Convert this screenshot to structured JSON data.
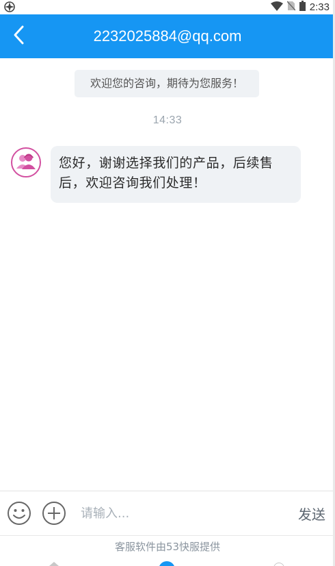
{
  "status_bar": {
    "time": "2:33",
    "icons": [
      "app-notification-icon",
      "wifi-icon",
      "no-sim-icon",
      "battery-icon"
    ]
  },
  "header": {
    "title": "2232025884@qq.com",
    "back_icon": "chevron-left-icon",
    "background_color": "#1696f3"
  },
  "chat": {
    "welcome_text": "欢迎您的咨询，期待为您服务！",
    "timestamp": "14:33",
    "messages": [
      {
        "sender": "agent",
        "avatar_icon": "customer-service-avatar-icon",
        "text": "您好，谢谢选择我们的产品，后续售后，欢迎咨询我们处理！"
      }
    ]
  },
  "input_bar": {
    "emoji_icon": "smiley-icon",
    "plus_icon": "plus-circle-icon",
    "placeholder": "请输入...",
    "value": "",
    "send_label": "发送"
  },
  "footer": {
    "text": "客服软件由53快服提供"
  }
}
